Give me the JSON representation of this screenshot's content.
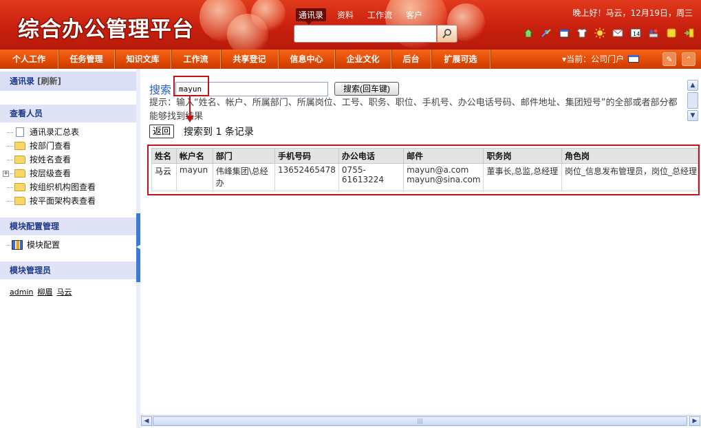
{
  "header": {
    "logo": "综合办公管理平台",
    "search_tabs": [
      "通讯录",
      "资料",
      "工作流",
      "客户"
    ],
    "greeting": "晚上好！马云，12月19日，周三"
  },
  "nav": {
    "items": [
      "个人工作",
      "任务管理",
      "知识文库",
      "工作流",
      "共享登记",
      "信息中心",
      "企业文化",
      "后台",
      "扩展可选"
    ],
    "current": "当前：公司门户"
  },
  "sidebar": {
    "title": "通讯录",
    "refresh": "[刷新]",
    "view_section": "查看人员",
    "view_items": [
      "通讯录汇总表",
      "按部门查看",
      "按姓名查看",
      "按层级查看",
      "按组织机构图查看",
      "按平面架构表查看"
    ],
    "config_section": "模块配置管理",
    "config_item": "模块配置",
    "admin_section": "模块管理员",
    "admins": [
      "admin",
      "柳眉",
      "马云"
    ]
  },
  "main": {
    "search_label": "搜索",
    "search_value": "mayun",
    "search_button": "搜索(回车键)",
    "hint": "提示：输入“姓名、帐户、所属部门、所属岗位、工号、职务、职位、手机号、办公电话号码、邮件地址、集团短号”的全部或者部分都能够找到结果",
    "back_button": "返回",
    "result_text": "搜索到 1 条记录",
    "table": {
      "headers": [
        "姓名",
        "帐户名",
        "部门",
        "手机号码",
        "办公电话",
        "邮件",
        "职务岗",
        "角色岗"
      ],
      "row": {
        "name": "马云",
        "account": "mayun",
        "department": "伟峰集团\\总经办",
        "mobile": "13652465478",
        "office_phone": "0755-61613224",
        "email1": "mayun@a.com",
        "email2": "mayun@sina.com",
        "duty": "董事长,总监,总经理",
        "role": "岗位_信息发布管理员，岗位_总经理"
      }
    }
  },
  "colors": {
    "header_red": "#c8200e",
    "nav_orange": "#e04a06",
    "highlight_red": "#c0141b",
    "sidebar_head": "#dfe3f5",
    "link_blue": "#2a5fd0"
  }
}
